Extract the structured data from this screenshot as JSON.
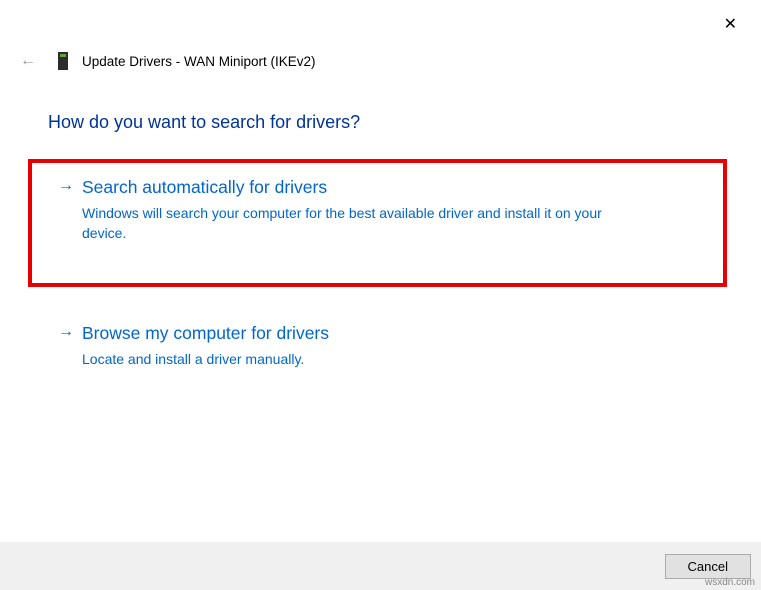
{
  "header": {
    "title": "Update Drivers - WAN Miniport (IKEv2)"
  },
  "heading": "How do you want to search for drivers?",
  "options": {
    "auto": {
      "title": "Search automatically for drivers",
      "desc": "Windows will search your computer for the best available driver and install it on your device."
    },
    "browse": {
      "title": "Browse my computer for drivers",
      "desc": "Locate and install a driver manually."
    }
  },
  "footer": {
    "cancel": "Cancel"
  },
  "watermark": "wsxdn.com"
}
